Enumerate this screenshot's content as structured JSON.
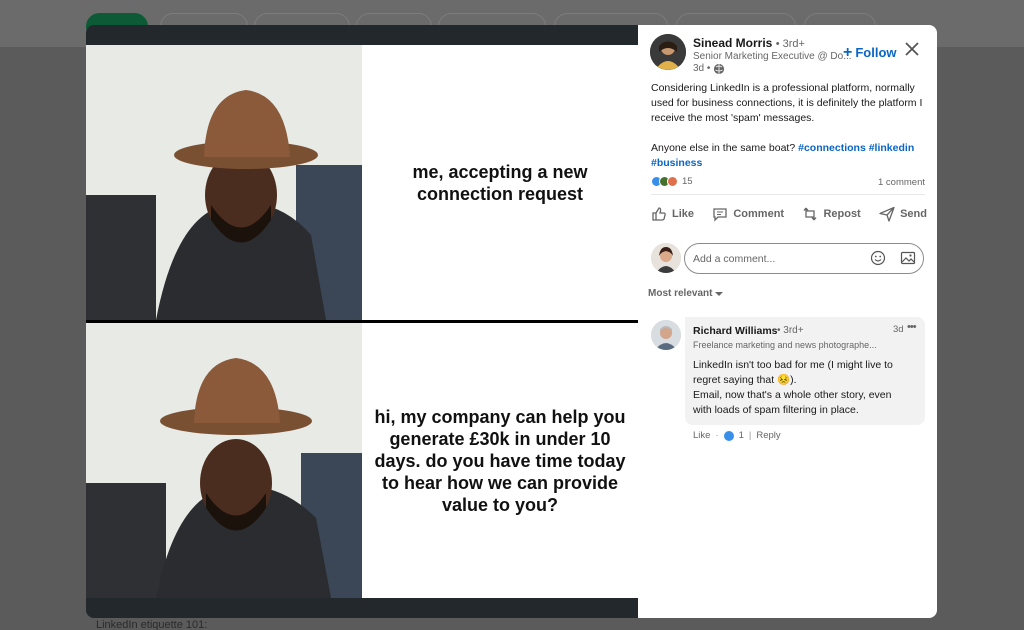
{
  "background": {
    "caption": "LinkedIn etiquette 101:"
  },
  "meme": {
    "top_text": "me, accepting a new connection request",
    "bottom_text": "hi, my company can help you generate £30k in under 10 days. do you have time today to hear how we can provide value to you?"
  },
  "post": {
    "author_name": "Sinead Morris",
    "author_degree": "• 3rd+",
    "author_headline": "Senior Marketing Executive @ Do...",
    "time": "3d •",
    "follow_label": "Follow",
    "body_paragraph_1": "Considering LinkedIn is a professional platform, normally used for business connections, it is definitely the platform I receive the most 'spam' messages.",
    "body_paragraph_2": "Anyone else in the same boat?",
    "hashtags": [
      "#connections",
      "#linkedin",
      "#business"
    ],
    "reaction_count": "15",
    "comment_count": "1 comment",
    "reaction_colors": [
      "#378fe9",
      "#44712e",
      "#df704d"
    ]
  },
  "actions": {
    "like": "Like",
    "comment": "Comment",
    "repost": "Repost",
    "send": "Send"
  },
  "comment_box": {
    "placeholder": "Add a comment..."
  },
  "sort": {
    "label": "Most relevant"
  },
  "comment": {
    "name": "Richard Williams",
    "degree": "• 3rd+",
    "time": "3d",
    "more": "•••",
    "headline": "Freelance marketing and news photographe...",
    "line_1": "LinkedIn isn't too bad for me (I might live to",
    "line_2": "regret saying that 😣).",
    "line_3": "Email, now that's a whole other story, even",
    "line_4": "with loads of spam filtering in place.",
    "like_label": "Like",
    "reaction_count": "1",
    "reply_label": "Reply"
  },
  "colors": {
    "accent": "#0a66c2",
    "text": "#191919",
    "muted": "#666666"
  }
}
